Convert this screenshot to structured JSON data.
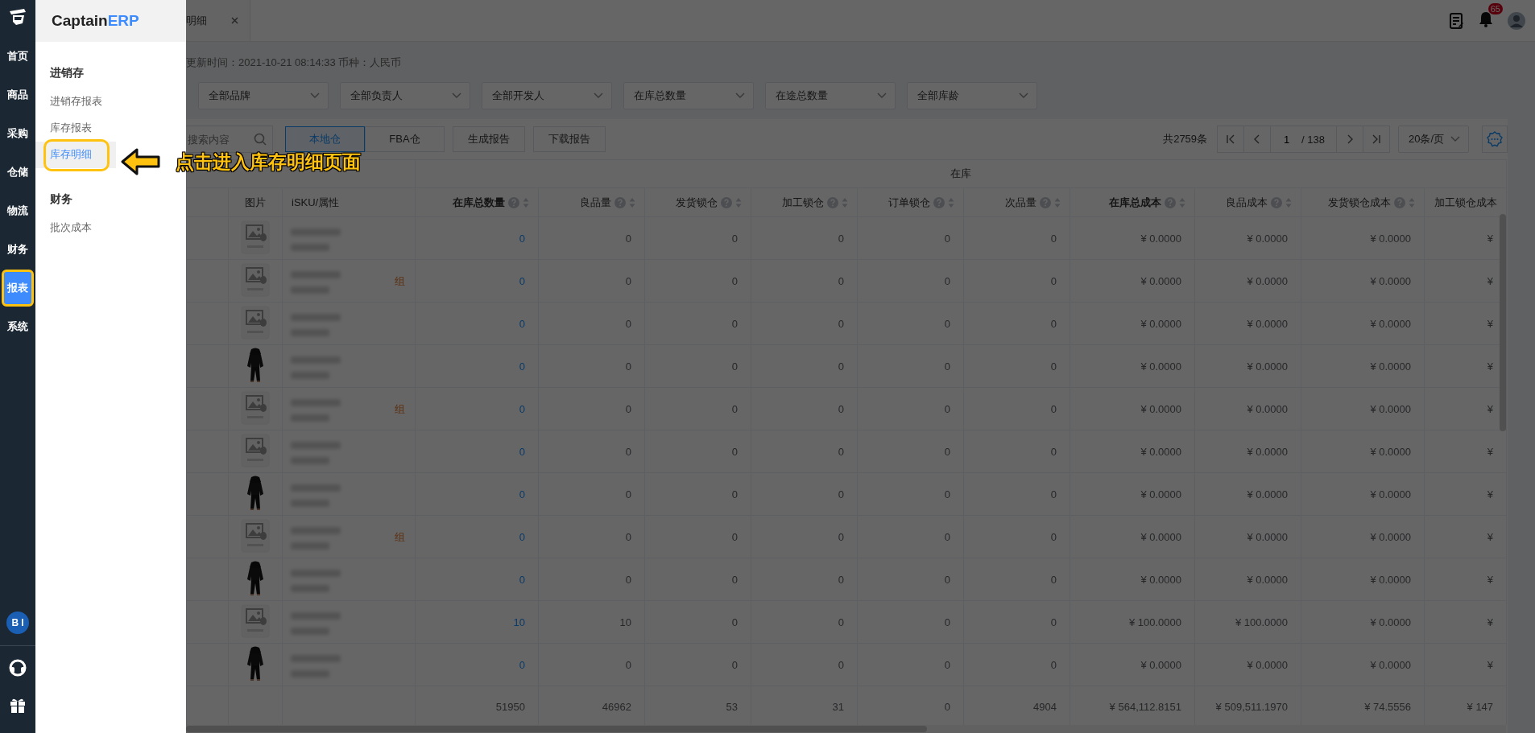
{
  "nav": {
    "items": [
      {
        "label": "首页",
        "selected": false,
        "highlighted": false
      },
      {
        "label": "商品",
        "selected": false,
        "highlighted": false
      },
      {
        "label": "采购",
        "selected": false,
        "highlighted": false
      },
      {
        "label": "仓储",
        "selected": false,
        "highlighted": false
      },
      {
        "label": "物流",
        "selected": false,
        "highlighted": false
      },
      {
        "label": "财务",
        "selected": false,
        "highlighted": false
      },
      {
        "label": "报表",
        "selected": true,
        "highlighted": true
      },
      {
        "label": "系统",
        "selected": false,
        "highlighted": false
      }
    ],
    "bi_label": "BI"
  },
  "menu_panel": {
    "brand_main": "Captain",
    "brand_accent": "ERP",
    "sections": [
      {
        "title": "进销存",
        "items": [
          {
            "label": "进销存报表",
            "selected": false,
            "highlighted": false
          },
          {
            "label": "库存报表",
            "selected": false,
            "highlighted": false
          },
          {
            "label": "库存明细",
            "selected": true,
            "highlighted": true
          }
        ]
      },
      {
        "title": "财务",
        "items": [
          {
            "label": "批次成本",
            "selected": false,
            "highlighted": false
          }
        ]
      }
    ]
  },
  "tab": {
    "label": "明细"
  },
  "header": {
    "notification_count": "65"
  },
  "info": "更新时间：2021-10-21 08:14:33  币种：人民币",
  "filters": [
    "全部品牌",
    "全部负责人",
    "全部开发人",
    "在库总数量",
    "在途总数量",
    "全部库龄"
  ],
  "search": {
    "placeholder": "搜索内容"
  },
  "warehouse_tabs": [
    {
      "label": "本地仓",
      "selected": true
    },
    {
      "label": "FBA仓",
      "selected": false
    }
  ],
  "actions": [
    "生成报告",
    "下载报告"
  ],
  "pagination": {
    "total": "共2759条",
    "page": "1",
    "pages": "/ 138",
    "page_size": "20条/页"
  },
  "table": {
    "group_label": "在库",
    "columns": [
      {
        "label": "图片",
        "emphasized": false,
        "help": false
      },
      {
        "label": "iSKU/属性",
        "emphasized": false,
        "help": false
      },
      {
        "label": "在库总数量",
        "emphasized": true,
        "help": true
      },
      {
        "label": "良品量",
        "emphasized": false,
        "help": true
      },
      {
        "label": "发货锁仓",
        "emphasized": false,
        "help": true
      },
      {
        "label": "加工锁仓",
        "emphasized": false,
        "help": true
      },
      {
        "label": "订单锁仓",
        "emphasized": false,
        "help": true
      },
      {
        "label": "次品量",
        "emphasized": false,
        "help": true
      },
      {
        "label": "在库总成本",
        "emphasized": true,
        "help": true
      },
      {
        "label": "良品成本",
        "emphasized": false,
        "help": true
      },
      {
        "label": "发货锁仓成本",
        "emphasized": false,
        "help": true
      },
      {
        "label": "加工锁仓成本",
        "emphasized": false,
        "help": false
      }
    ],
    "rows": [
      {
        "kind": "placeholder",
        "values": [
          "0",
          "0",
          "0",
          "0",
          "0",
          "0",
          "¥ 0.0000",
          "¥ 0.0000",
          "¥ 0.0000",
          "¥"
        ]
      },
      {
        "kind": "placeholder",
        "tag": "组",
        "values": [
          "0",
          "0",
          "0",
          "0",
          "0",
          "0",
          "¥ 0.0000",
          "¥ 0.0000",
          "¥ 0.0000",
          "¥"
        ]
      },
      {
        "kind": "placeholder",
        "values": [
          "0",
          "0",
          "0",
          "0",
          "0",
          "0",
          "¥ 0.0000",
          "¥ 0.0000",
          "¥ 0.0000",
          "¥"
        ]
      },
      {
        "kind": "picture",
        "values": [
          "0",
          "0",
          "0",
          "0",
          "0",
          "0",
          "¥ 0.0000",
          "¥ 0.0000",
          "¥ 0.0000",
          "¥"
        ]
      },
      {
        "kind": "placeholder",
        "tag": "组",
        "values": [
          "0",
          "0",
          "0",
          "0",
          "0",
          "0",
          "¥ 0.0000",
          "¥ 0.0000",
          "¥ 0.0000",
          "¥"
        ]
      },
      {
        "kind": "placeholder",
        "values": [
          "0",
          "0",
          "0",
          "0",
          "0",
          "0",
          "¥ 0.0000",
          "¥ 0.0000",
          "¥ 0.0000",
          "¥"
        ]
      },
      {
        "kind": "picture",
        "values": [
          "0",
          "0",
          "0",
          "0",
          "0",
          "0",
          "¥ 0.0000",
          "¥ 0.0000",
          "¥ 0.0000",
          "¥"
        ]
      },
      {
        "kind": "placeholder",
        "tag": "组",
        "values": [
          "0",
          "0",
          "0",
          "0",
          "0",
          "0",
          "¥ 0.0000",
          "¥ 0.0000",
          "¥ 0.0000",
          "¥"
        ]
      },
      {
        "kind": "picture",
        "values": [
          "0",
          "0",
          "0",
          "0",
          "0",
          "0",
          "¥ 0.0000",
          "¥ 0.0000",
          "¥ 0.0000",
          "¥"
        ]
      },
      {
        "kind": "placeholder",
        "values": [
          "10",
          "10",
          "0",
          "0",
          "0",
          "0",
          "¥ 100.0000",
          "¥ 100.0000",
          "¥ 0.0000",
          "¥"
        ]
      },
      {
        "kind": "picture",
        "values": [
          "0",
          "0",
          "0",
          "0",
          "0",
          "0",
          "¥ 0.0000",
          "¥ 0.0000",
          "¥ 0.0000",
          "¥"
        ]
      }
    ],
    "total": [
      "51950",
      "46962",
      "53",
      "31",
      "0",
      "4904",
      "¥ 564,112.8151",
      "¥ 509,511.1970",
      "¥ 74.5556",
      "¥ 147"
    ]
  },
  "annotation": {
    "text": "点击进入库存明细页面"
  }
}
